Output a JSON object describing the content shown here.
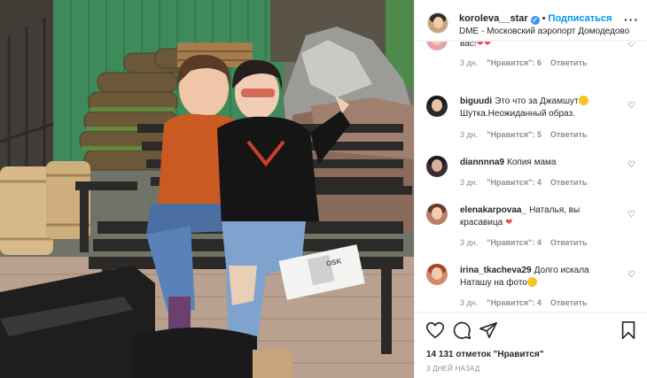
{
  "post": {
    "username": "koroleva__star",
    "follow_label": "Подписаться",
    "location": "DME - Московский аэропорт Домодедово",
    "more_icon": "ellipsis-icon"
  },
  "photo": {
    "magazine_title": "OSK"
  },
  "comments": [
    {
      "username": "",
      "text": "вас!",
      "emoji": "red-heart-emoji",
      "time": "3 дн.",
      "likes": "\"Нравится\": 6",
      "reply": "Ответить"
    },
    {
      "username": "biguudi",
      "text": "Это что за Джамшут",
      "text2": "Шутка.Неожиданный образ.",
      "emoji": "grinning-sweat-emoji",
      "time": "3 дн.",
      "likes": "\"Нравится\": 5",
      "reply": "Ответить"
    },
    {
      "username": "diannnna9",
      "text": "Копия мама",
      "time": "3 дн.",
      "likes": "\"Нравится\": 4",
      "reply": "Ответить"
    },
    {
      "username": "elenakarpovaa_",
      "text": "Наталья, вы красавица",
      "emoji": "red-heart-emoji",
      "time": "3 дн.",
      "likes": "\"Нравится\": 4",
      "reply": "Ответить"
    },
    {
      "username": "irina_tkacheva29",
      "text": "Долго искала Наташу на фото",
      "emoji": "grinning-sweat-emoji",
      "time": "3 дн.",
      "likes": "\"Нравится\": 4",
      "reply": "Ответить"
    }
  ],
  "actions": {
    "likes_count": "14 131 отметок \"Нравится\"",
    "time_ago": "3 ДНЕЙ НАЗАД"
  },
  "colors": {
    "link_blue": "#0095f6",
    "verified_blue": "#3897f0",
    "heart_red": "#ed4956",
    "meta_gray": "#8e8e8e"
  }
}
